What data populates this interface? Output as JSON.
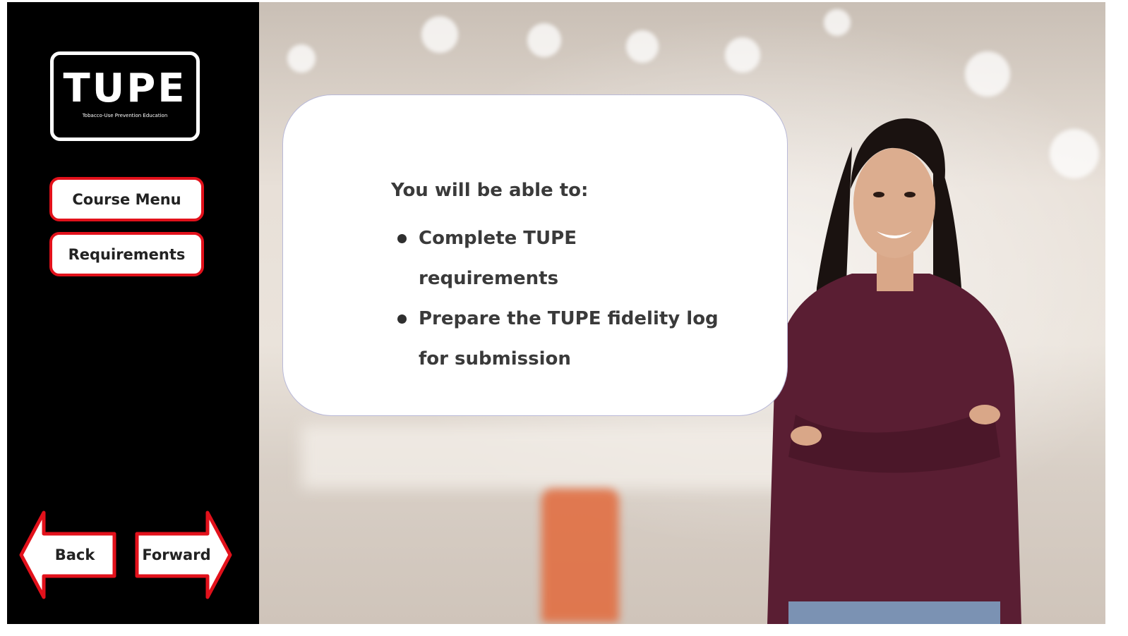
{
  "sidebar": {
    "logo": {
      "title": "TUPE",
      "subtitle": "Tobacco-Use Prevention Education"
    },
    "buttons": {
      "course_menu": "Course Menu",
      "requirements": "Requirements"
    },
    "nav": {
      "back": "Back",
      "forward": "Forward"
    }
  },
  "content": {
    "heading": "You will be able to:",
    "bullets": [
      "Complete TUPE requirements",
      "Prepare the TUPE fidelity log for submission"
    ]
  },
  "colors": {
    "sidebar_bg": "#000000",
    "button_border": "#e2111b",
    "card_bg": "#ffffff",
    "text": "#3a3a3a",
    "shirt": "#5a1e33"
  }
}
